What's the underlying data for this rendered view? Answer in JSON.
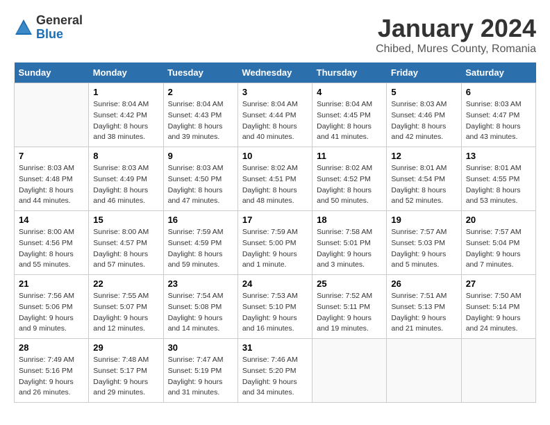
{
  "header": {
    "logo_general": "General",
    "logo_blue": "Blue",
    "month": "January 2024",
    "location": "Chibed, Mures County, Romania"
  },
  "weekdays": [
    "Sunday",
    "Monday",
    "Tuesday",
    "Wednesday",
    "Thursday",
    "Friday",
    "Saturday"
  ],
  "weeks": [
    [
      {
        "day": "",
        "sunrise": "",
        "sunset": "",
        "daylight": ""
      },
      {
        "day": "1",
        "sunrise": "Sunrise: 8:04 AM",
        "sunset": "Sunset: 4:42 PM",
        "daylight": "Daylight: 8 hours and 38 minutes."
      },
      {
        "day": "2",
        "sunrise": "Sunrise: 8:04 AM",
        "sunset": "Sunset: 4:43 PM",
        "daylight": "Daylight: 8 hours and 39 minutes."
      },
      {
        "day": "3",
        "sunrise": "Sunrise: 8:04 AM",
        "sunset": "Sunset: 4:44 PM",
        "daylight": "Daylight: 8 hours and 40 minutes."
      },
      {
        "day": "4",
        "sunrise": "Sunrise: 8:04 AM",
        "sunset": "Sunset: 4:45 PM",
        "daylight": "Daylight: 8 hours and 41 minutes."
      },
      {
        "day": "5",
        "sunrise": "Sunrise: 8:03 AM",
        "sunset": "Sunset: 4:46 PM",
        "daylight": "Daylight: 8 hours and 42 minutes."
      },
      {
        "day": "6",
        "sunrise": "Sunrise: 8:03 AM",
        "sunset": "Sunset: 4:47 PM",
        "daylight": "Daylight: 8 hours and 43 minutes."
      }
    ],
    [
      {
        "day": "7",
        "sunrise": "Sunrise: 8:03 AM",
        "sunset": "Sunset: 4:48 PM",
        "daylight": "Daylight: 8 hours and 44 minutes."
      },
      {
        "day": "8",
        "sunrise": "Sunrise: 8:03 AM",
        "sunset": "Sunset: 4:49 PM",
        "daylight": "Daylight: 8 hours and 46 minutes."
      },
      {
        "day": "9",
        "sunrise": "Sunrise: 8:03 AM",
        "sunset": "Sunset: 4:50 PM",
        "daylight": "Daylight: 8 hours and 47 minutes."
      },
      {
        "day": "10",
        "sunrise": "Sunrise: 8:02 AM",
        "sunset": "Sunset: 4:51 PM",
        "daylight": "Daylight: 8 hours and 48 minutes."
      },
      {
        "day": "11",
        "sunrise": "Sunrise: 8:02 AM",
        "sunset": "Sunset: 4:52 PM",
        "daylight": "Daylight: 8 hours and 50 minutes."
      },
      {
        "day": "12",
        "sunrise": "Sunrise: 8:01 AM",
        "sunset": "Sunset: 4:54 PM",
        "daylight": "Daylight: 8 hours and 52 minutes."
      },
      {
        "day": "13",
        "sunrise": "Sunrise: 8:01 AM",
        "sunset": "Sunset: 4:55 PM",
        "daylight": "Daylight: 8 hours and 53 minutes."
      }
    ],
    [
      {
        "day": "14",
        "sunrise": "Sunrise: 8:00 AM",
        "sunset": "Sunset: 4:56 PM",
        "daylight": "Daylight: 8 hours and 55 minutes."
      },
      {
        "day": "15",
        "sunrise": "Sunrise: 8:00 AM",
        "sunset": "Sunset: 4:57 PM",
        "daylight": "Daylight: 8 hours and 57 minutes."
      },
      {
        "day": "16",
        "sunrise": "Sunrise: 7:59 AM",
        "sunset": "Sunset: 4:59 PM",
        "daylight": "Daylight: 8 hours and 59 minutes."
      },
      {
        "day": "17",
        "sunrise": "Sunrise: 7:59 AM",
        "sunset": "Sunset: 5:00 PM",
        "daylight": "Daylight: 9 hours and 1 minute."
      },
      {
        "day": "18",
        "sunrise": "Sunrise: 7:58 AM",
        "sunset": "Sunset: 5:01 PM",
        "daylight": "Daylight: 9 hours and 3 minutes."
      },
      {
        "day": "19",
        "sunrise": "Sunrise: 7:57 AM",
        "sunset": "Sunset: 5:03 PM",
        "daylight": "Daylight: 9 hours and 5 minutes."
      },
      {
        "day": "20",
        "sunrise": "Sunrise: 7:57 AM",
        "sunset": "Sunset: 5:04 PM",
        "daylight": "Daylight: 9 hours and 7 minutes."
      }
    ],
    [
      {
        "day": "21",
        "sunrise": "Sunrise: 7:56 AM",
        "sunset": "Sunset: 5:06 PM",
        "daylight": "Daylight: 9 hours and 9 minutes."
      },
      {
        "day": "22",
        "sunrise": "Sunrise: 7:55 AM",
        "sunset": "Sunset: 5:07 PM",
        "daylight": "Daylight: 9 hours and 12 minutes."
      },
      {
        "day": "23",
        "sunrise": "Sunrise: 7:54 AM",
        "sunset": "Sunset: 5:08 PM",
        "daylight": "Daylight: 9 hours and 14 minutes."
      },
      {
        "day": "24",
        "sunrise": "Sunrise: 7:53 AM",
        "sunset": "Sunset: 5:10 PM",
        "daylight": "Daylight: 9 hours and 16 minutes."
      },
      {
        "day": "25",
        "sunrise": "Sunrise: 7:52 AM",
        "sunset": "Sunset: 5:11 PM",
        "daylight": "Daylight: 9 hours and 19 minutes."
      },
      {
        "day": "26",
        "sunrise": "Sunrise: 7:51 AM",
        "sunset": "Sunset: 5:13 PM",
        "daylight": "Daylight: 9 hours and 21 minutes."
      },
      {
        "day": "27",
        "sunrise": "Sunrise: 7:50 AM",
        "sunset": "Sunset: 5:14 PM",
        "daylight": "Daylight: 9 hours and 24 minutes."
      }
    ],
    [
      {
        "day": "28",
        "sunrise": "Sunrise: 7:49 AM",
        "sunset": "Sunset: 5:16 PM",
        "daylight": "Daylight: 9 hours and 26 minutes."
      },
      {
        "day": "29",
        "sunrise": "Sunrise: 7:48 AM",
        "sunset": "Sunset: 5:17 PM",
        "daylight": "Daylight: 9 hours and 29 minutes."
      },
      {
        "day": "30",
        "sunrise": "Sunrise: 7:47 AM",
        "sunset": "Sunset: 5:19 PM",
        "daylight": "Daylight: 9 hours and 31 minutes."
      },
      {
        "day": "31",
        "sunrise": "Sunrise: 7:46 AM",
        "sunset": "Sunset: 5:20 PM",
        "daylight": "Daylight: 9 hours and 34 minutes."
      },
      {
        "day": "",
        "sunrise": "",
        "sunset": "",
        "daylight": ""
      },
      {
        "day": "",
        "sunrise": "",
        "sunset": "",
        "daylight": ""
      },
      {
        "day": "",
        "sunrise": "",
        "sunset": "",
        "daylight": ""
      }
    ]
  ]
}
